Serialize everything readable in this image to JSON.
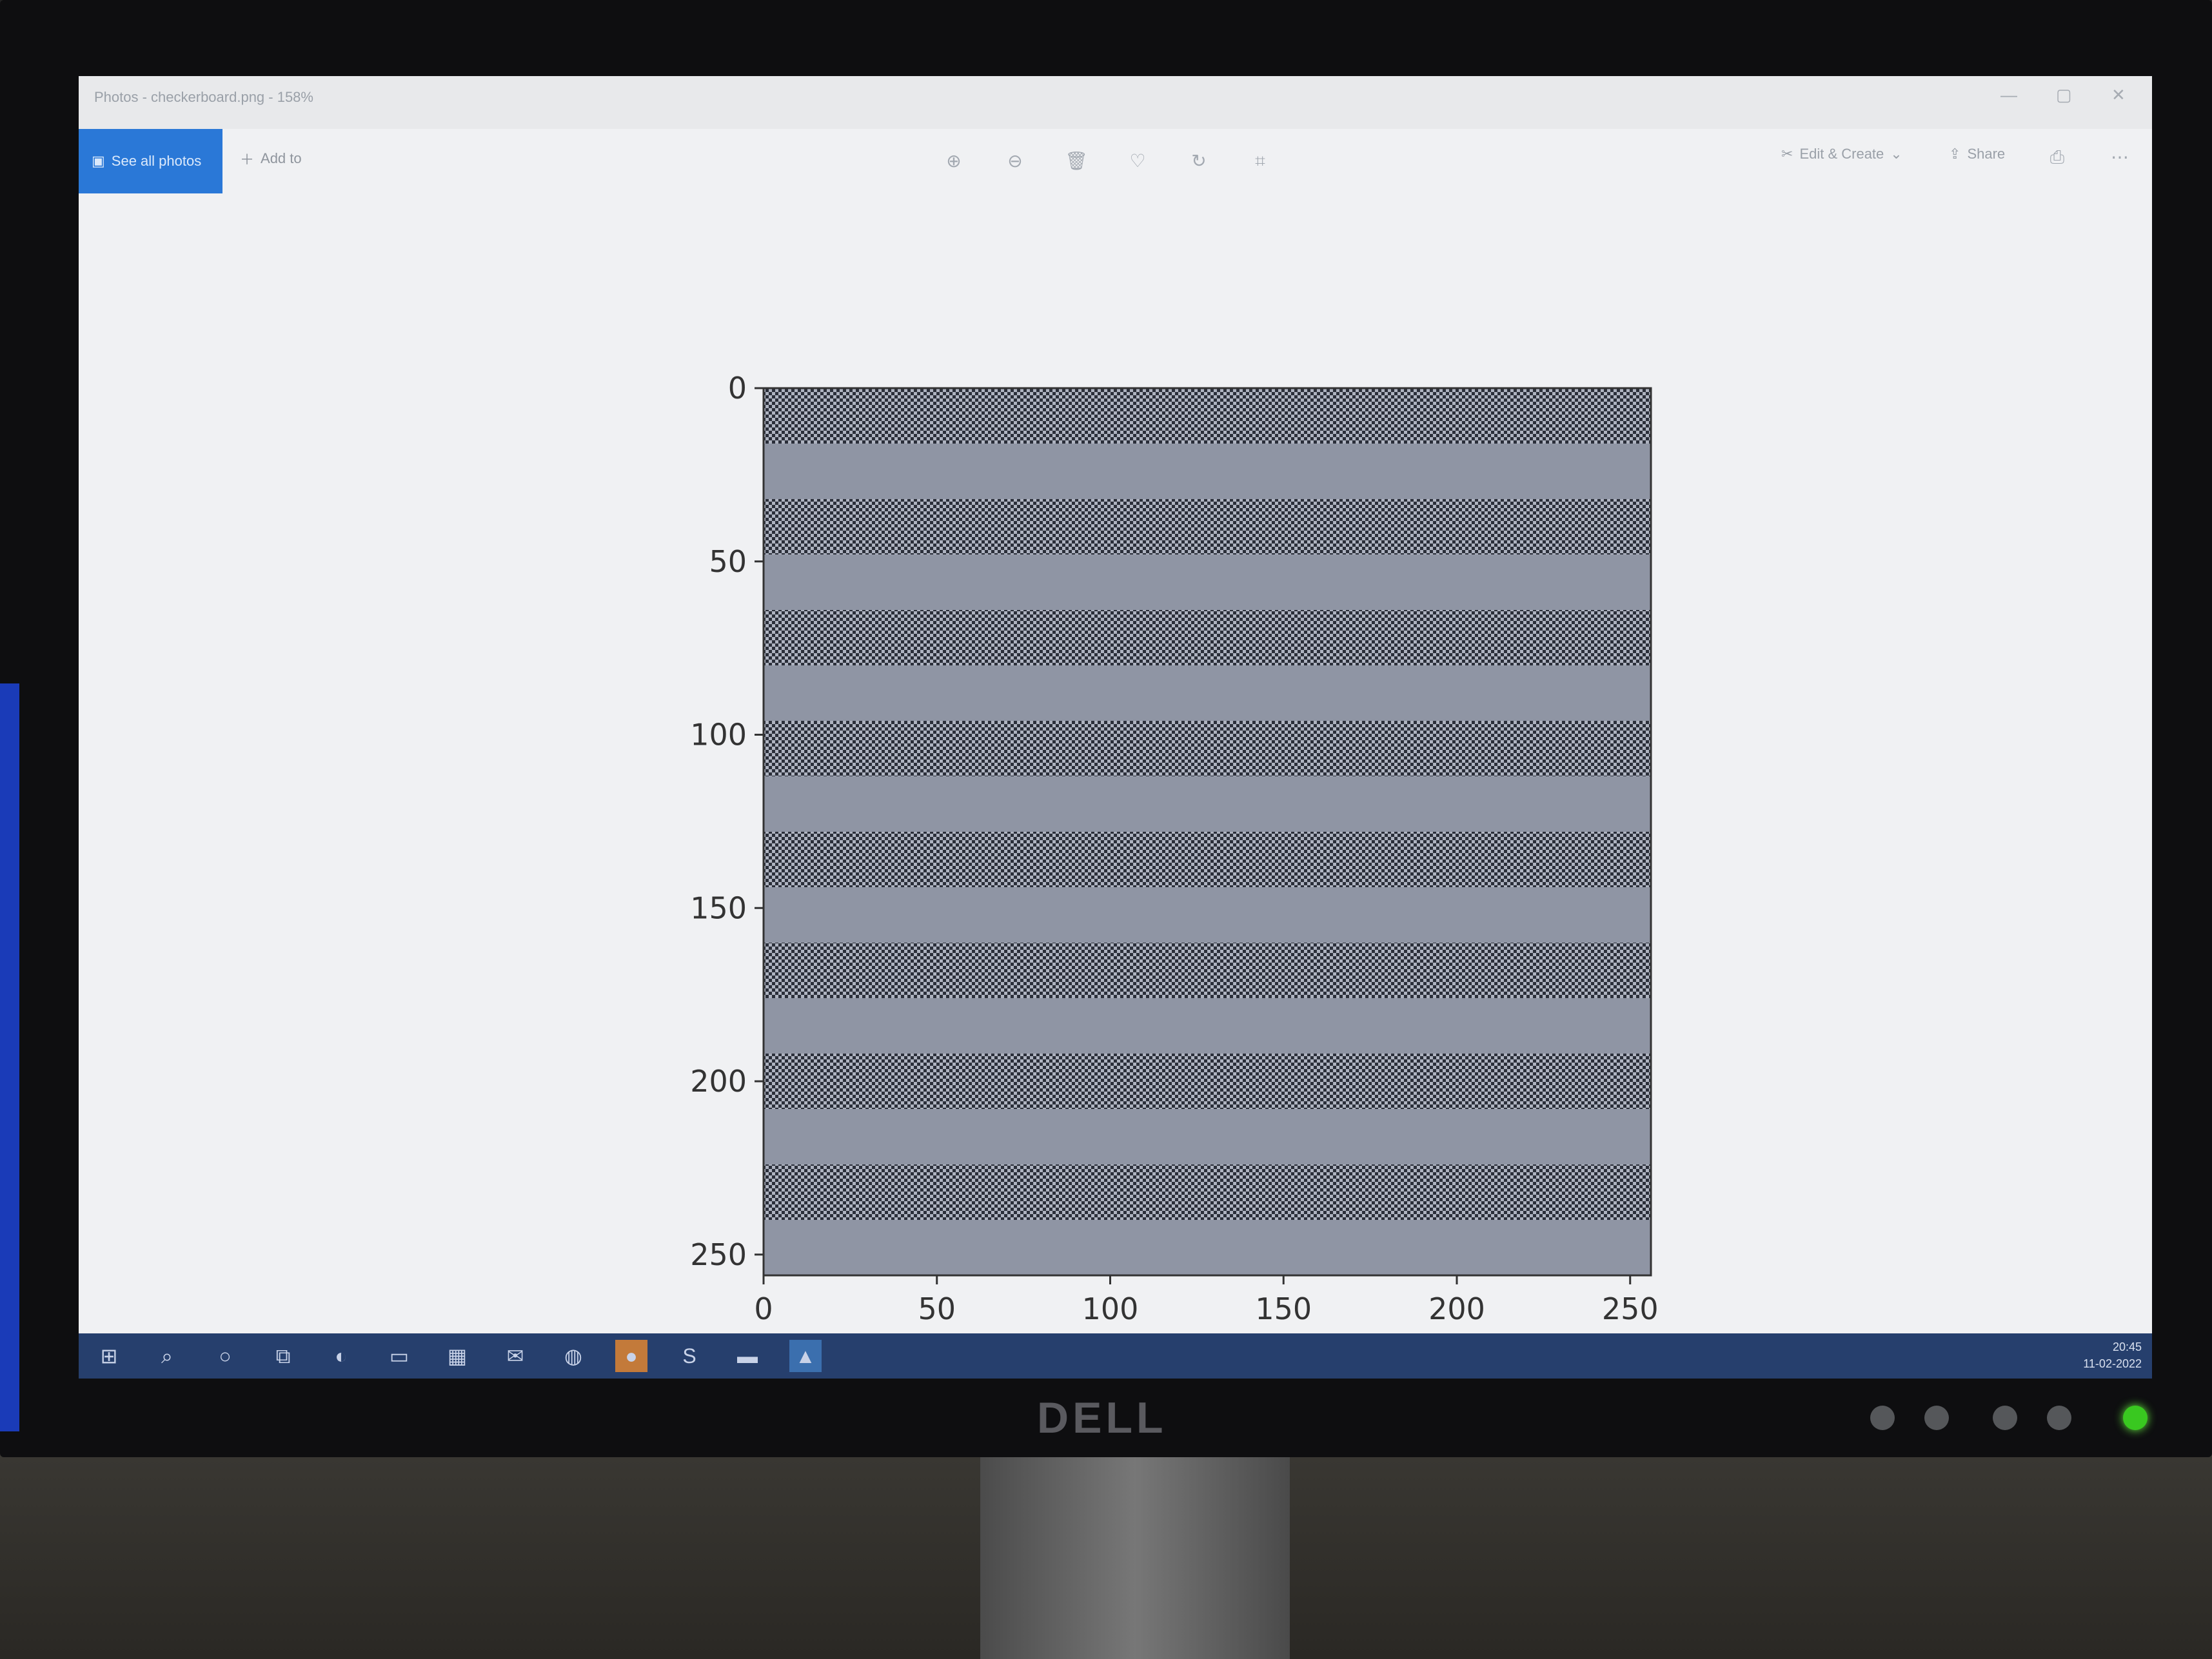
{
  "window": {
    "title": "Photos - checkerboard.png - 158%",
    "minimize": "—",
    "maximize": "▢",
    "close": "✕"
  },
  "toolbar": {
    "see_all_label": "See all photos",
    "add_to_label": "Add to",
    "edit_create_label": "Edit & Create",
    "share_label": "Share",
    "icons": [
      "zoom-in-icon",
      "zoom-out-icon",
      "delete-icon",
      "heart-icon",
      "rotate-icon",
      "crop-icon",
      "print-icon",
      "more-icon"
    ]
  },
  "chart_data": {
    "type": "heatmap",
    "title": "",
    "xlabel": "",
    "ylabel": "",
    "xlim": [
      0,
      256
    ],
    "ylim": [
      256,
      0
    ],
    "xticks": [
      "0",
      "50",
      "100",
      "150",
      "200",
      "250"
    ],
    "yticks": [
      "0",
      "50",
      "100",
      "150",
      "200",
      "250"
    ],
    "stripes": {
      "count": 16,
      "height": 16,
      "pattern_rows": [
        0,
        2,
        4,
        6,
        8,
        10,
        12,
        14
      ],
      "plain_rows": [
        1,
        3,
        5,
        7,
        9,
        11,
        13,
        15
      ]
    },
    "colors": {
      "checker_dark": "#2b2f3a",
      "checker_light": "#aeb3c0",
      "plain": "#8f95a4"
    }
  },
  "taskbar": {
    "clock_time": "20:45",
    "clock_date": "11-02-2022"
  },
  "monitor": {
    "brand": "DELL"
  }
}
